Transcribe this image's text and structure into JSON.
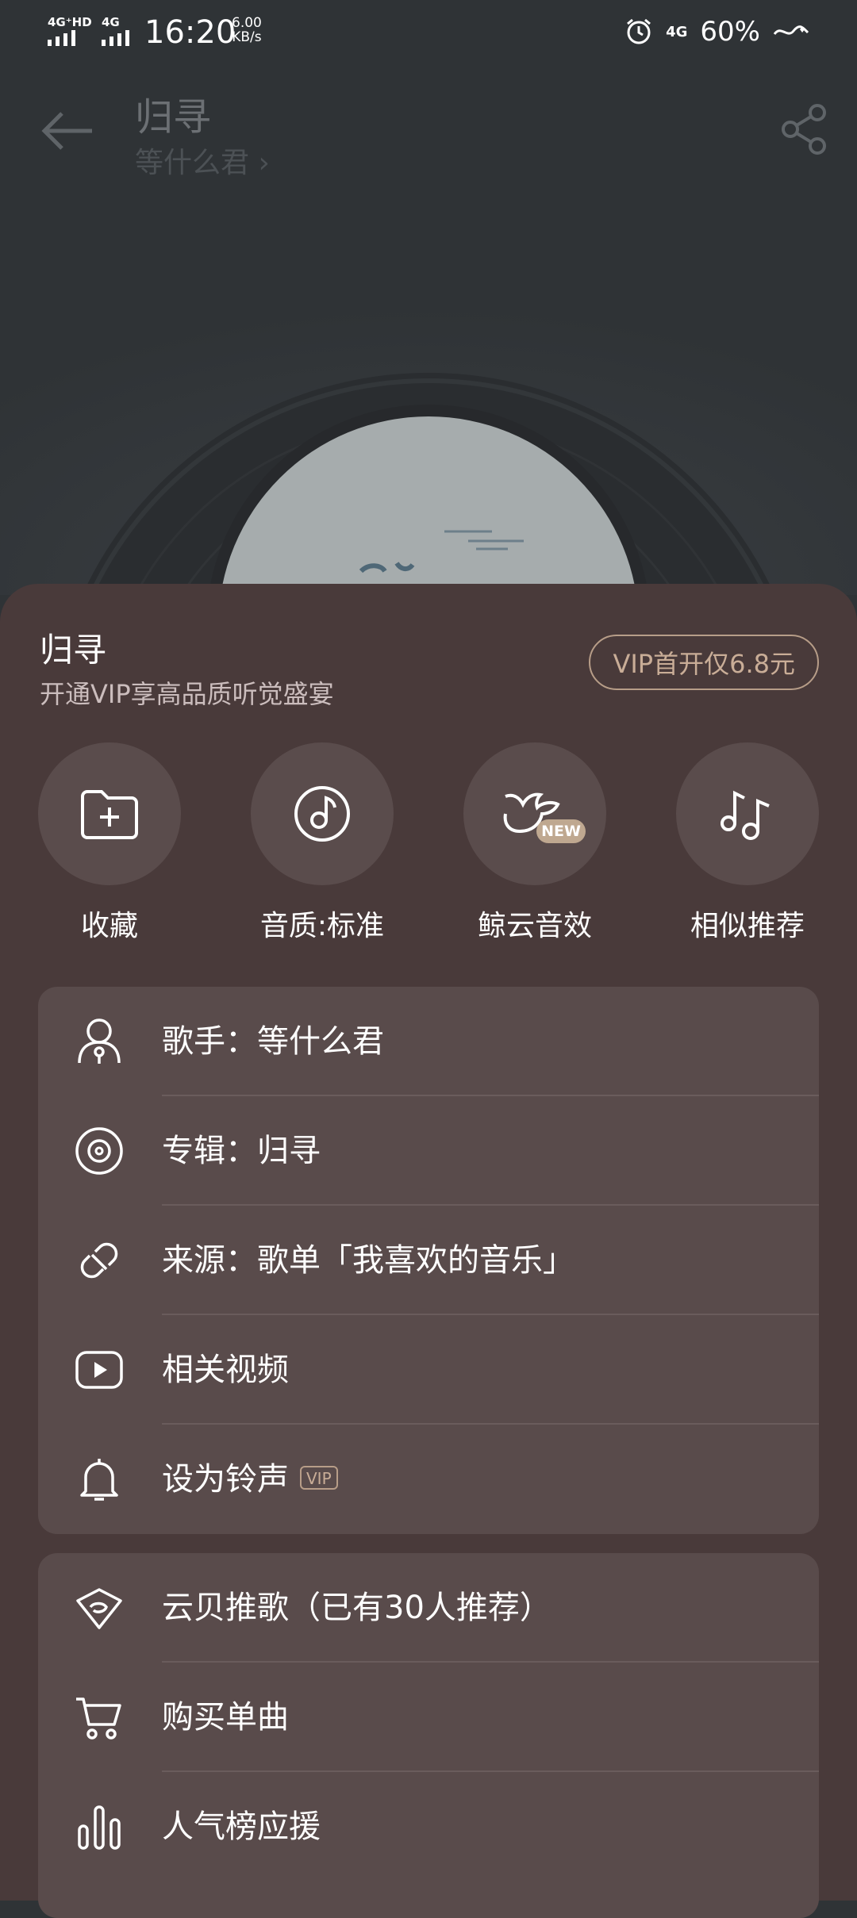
{
  "status_bar": {
    "sim1": "4G⁺HD",
    "sim2": "4G",
    "time": "16:20",
    "speed_value": "6.00",
    "speed_unit": "KB/s",
    "network_right": "4G",
    "battery": "60%"
  },
  "header": {
    "song_title": "归寻",
    "artist": "等什么君 ›"
  },
  "sheet": {
    "title": "归寻",
    "subtitle": "开通VIP享高品质听觉盛宴",
    "vip_button": "VIP首开仅6.8元",
    "actions": [
      {
        "label": "收藏",
        "icon": "folder-add-icon"
      },
      {
        "label": "音质:标准",
        "icon": "music-disc-icon"
      },
      {
        "label": "鲸云音效",
        "icon": "whale-icon",
        "badge": "NEW"
      },
      {
        "label": "相似推荐",
        "icon": "music-notes-icon"
      }
    ],
    "info_rows": [
      {
        "label": "歌手：等什么君",
        "icon": "singer-icon"
      },
      {
        "label": "专辑：归寻",
        "icon": "album-icon"
      },
      {
        "label": "来源：歌单「我喜欢的音乐」",
        "icon": "link-icon"
      },
      {
        "label": "相关视频",
        "icon": "video-icon"
      },
      {
        "label": "设为铃声",
        "icon": "bell-icon",
        "tag": "VIP"
      }
    ],
    "extra_rows": [
      {
        "label": "云贝推歌（已有30人推荐）",
        "icon": "cloud-coin-icon"
      },
      {
        "label": "购买单曲",
        "icon": "cart-icon"
      },
      {
        "label": "人气榜应援",
        "icon": "chart-bars-icon"
      }
    ]
  },
  "colors": {
    "background": "#2f3336",
    "sheet": "#493a3a",
    "card": "#594b4b",
    "vip_accent": "#c9ad97"
  }
}
